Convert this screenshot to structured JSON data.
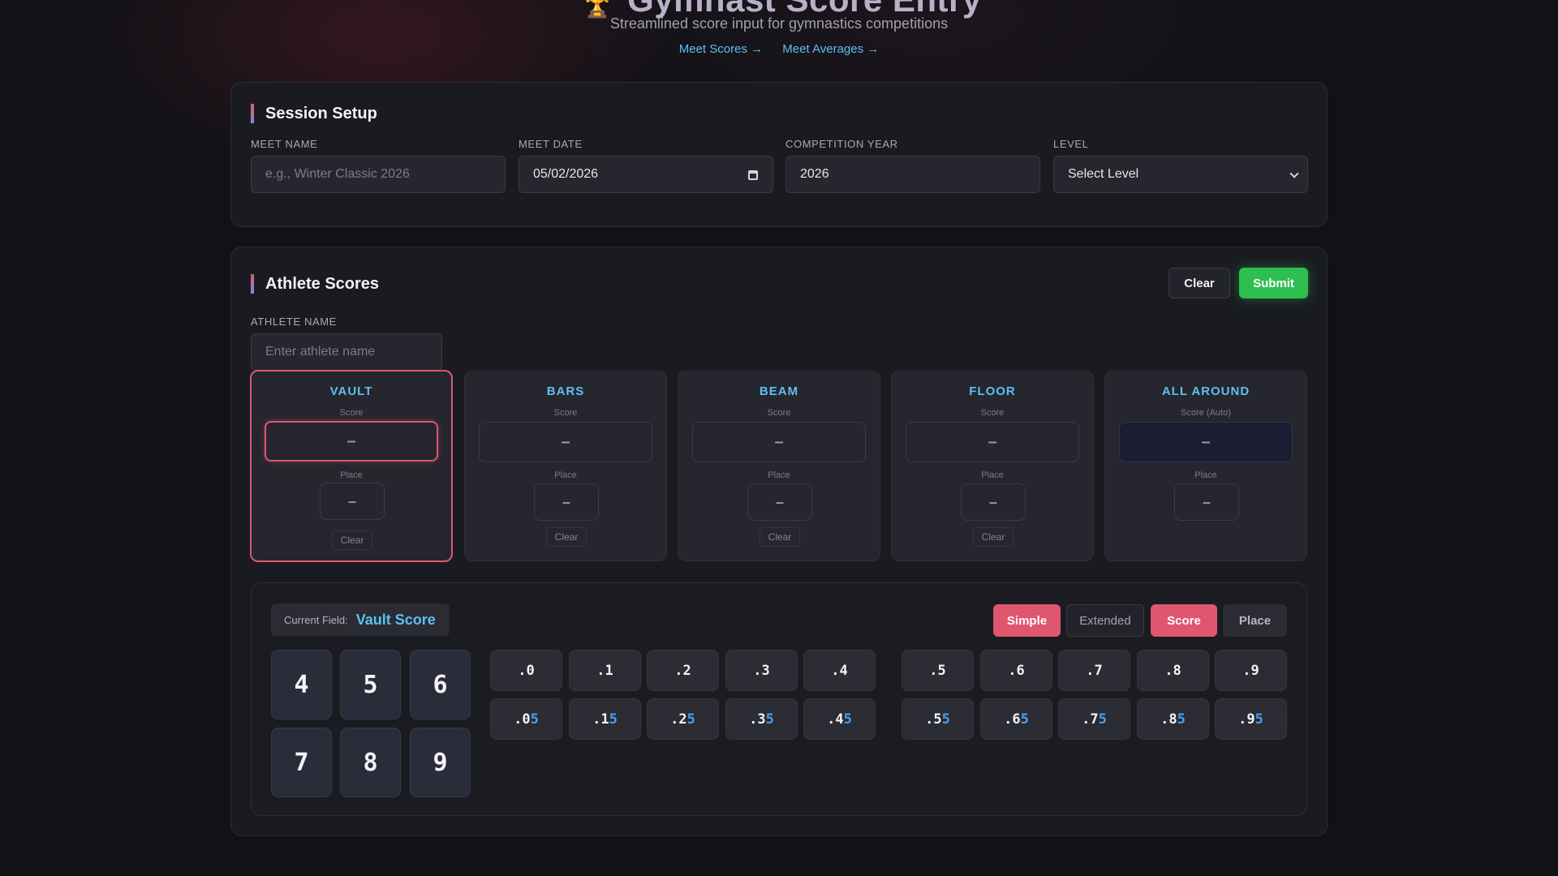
{
  "header": {
    "title": "Gymnast Score Entry",
    "subtitle": "Streamlined score input for gymnastics competitions",
    "links": [
      "Meet Scores →",
      "Meet Averages →"
    ]
  },
  "session": {
    "title": "Session Setup",
    "meet_name_label": "MEET NAME",
    "meet_name_placeholder": "e.g., Winter Classic 2026",
    "meet_date_label": "MEET DATE",
    "meet_date_value": "05/02/2026",
    "year_label": "COMPETITION YEAR",
    "year_value": "2026",
    "level_label": "LEVEL",
    "level_value": "Select Level"
  },
  "athlete": {
    "title": "Athlete Scores",
    "clear_label": "Clear",
    "submit_label": "Submit",
    "name_label": "ATHLETE NAME",
    "name_placeholder": "Enter athlete name"
  },
  "events": [
    {
      "name": "VAULT",
      "score_label": "Score",
      "score": "–",
      "place_label": "Place",
      "place": "–",
      "clear": "Clear"
    },
    {
      "name": "BARS",
      "score_label": "Score",
      "score": "–",
      "place_label": "Place",
      "place": "–",
      "clear": "Clear"
    },
    {
      "name": "BEAM",
      "score_label": "Score",
      "score": "–",
      "place_label": "Place",
      "place": "–",
      "clear": "Clear"
    },
    {
      "name": "FLOOR",
      "score_label": "Score",
      "score": "–",
      "place_label": "Place",
      "place": "–",
      "clear": "Clear"
    },
    {
      "name": "ALL AROUND",
      "score_label": "Score (Auto)",
      "score": "–",
      "place_label": "Place",
      "place": "–"
    }
  ],
  "keypad": {
    "current_field_label": "Current Field:",
    "current_field_value": "Vault Score",
    "modes": [
      "Simple",
      "Extended",
      "Score",
      "Place"
    ],
    "digits": [
      "4",
      "5",
      "6",
      "7",
      "8",
      "9"
    ],
    "tenths_a": [
      ".0",
      ".1",
      ".2",
      ".3",
      ".4"
    ],
    "tenths_b": [
      ".5",
      ".6",
      ".7",
      ".8",
      ".9"
    ],
    "hundredths_a": [
      ".0",
      ".1",
      ".2",
      ".3",
      ".4"
    ],
    "hundredths_b": [
      ".5",
      ".6",
      ".7",
      ".8",
      ".9"
    ],
    "hundredth_suffix": "5"
  },
  "colors": {
    "accent": "#e0566f",
    "link": "#5ec0f0",
    "submit": "#2dbf4f"
  }
}
